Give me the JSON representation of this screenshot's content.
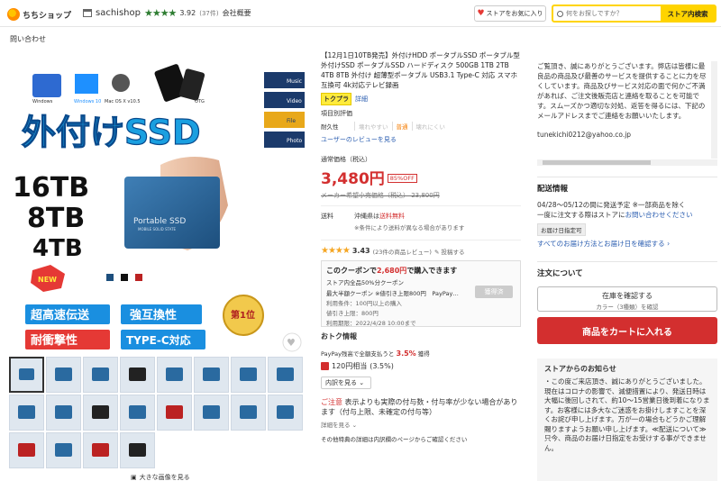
{
  "header": {
    "logo_text": "ちちショップ",
    "shop_name": "sachishop",
    "stars": "★★★★",
    "rating": "3.92",
    "rating_count": "(37件)",
    "company_link": "会社概要",
    "fav_label": "ストアをお気に入り",
    "search_placeholder": "何をお探しですか？",
    "search_button": "ストア内検索"
  },
  "inquiry": "問い合わせ",
  "main_image": {
    "compat": [
      "Windows",
      "Windows 10",
      "Mac OS X v10.5",
      "OTG"
    ],
    "side_icons": [
      "Music",
      "Video",
      "File",
      "Photo"
    ],
    "headline": "外付けSSD",
    "capacities": [
      "16TB",
      "8TB",
      "4TB"
    ],
    "device_label": "Portable SSD",
    "device_sub": "MOBILE SOLID STATE",
    "new_badge": "NEW",
    "rank_badge": "第1位",
    "features": [
      "超高速伝送",
      "強互換性",
      "耐衝撃性",
      "TYPE-C対応"
    ]
  },
  "big_image_link": "大きな画像を見る",
  "product": {
    "title": "【12月1日10TB発売】外付けHDD ポータブルSSD ポータブル型外付けSSD ポータブルSSD ハードディスク 500GB 1TB 2TB 4TB 8TB 外付け 超薄型ポータブル USB3.1 Type-C 対応 スマホ互換可 4k対応テレビ録画",
    "tokku_label": "トクプラ",
    "detail_link": "詳細",
    "eval_title": "項目別評価",
    "eval_label": "耐久性",
    "eval_opts": [
      "壊れやすい",
      "普通",
      "壊れにくい"
    ],
    "user_review_link": "ユーザーのレビューを見る",
    "price_label": "通常価格（税込）",
    "price": "3,480円",
    "discount": "85%OFF",
    "orig_price": "メーカー希望小売価格（税込） 23,800円",
    "ship_label": "送料",
    "ship_text_pre": "沖縄県は",
    "ship_text_free": "送料無料",
    "ship_note": "※条件により送料が異なる場合があります",
    "review_stars": "★★★★",
    "review_score": "3.43",
    "review_count": "(23件の商品レビュー)",
    "post_review": "投稿する"
  },
  "coupon": {
    "title_pre": "このクーポンで",
    "title_hl": "2,680円",
    "title_post": "で購入できます",
    "line1": "ストア内全品50%分クーポン",
    "line2": "最大半額クーポン ※値引き上限800円　PayPay…",
    "meta1": "利用条件：100円以上の購入",
    "meta2": "値引き上限：800円",
    "meta3": "利用期限：2022/4/28 10:00まで",
    "got_button": "獲得済"
  },
  "otoku": {
    "title": "おトク情報",
    "paypay_pre": "PayPay残高で全額支払うと",
    "paypay_pct": "3.5%",
    "paypay_post": "獲得",
    "points": "120円相当",
    "points_pct": "(3.5%)",
    "detail_select": "内訳を見る"
  },
  "caution": {
    "accent": "ご注意",
    "text": "表示よりも実際の付与数・付与率が少ない場合があります（付与上限、未確定の付与等）",
    "see_detail": "詳細を見る",
    "other": "その他特典の詳細は内訳欄のページからご確認ください"
  },
  "store_msg": "ご覧頂き、誠にありがとうございます。弊店は皆様に最良品の商品及び最善のサービスを提供することに力を尽くしています。商品及びサービス対応の面で何かご不満があれば、ご注文後販売店と連絡を取ることを可能です。スムーズかつ適切な対処、返答を得るには、下記のメールアドレスまでご連絡をお願いいたします。",
  "store_email": "tunekichi0212@yahoo.co.jp",
  "shipping": {
    "title": "配送情報",
    "date_range": "04/28〜05/12の間に発送予定",
    "date_note": "※一部商品を除く",
    "date_note2": "一度に注文する際はストアに",
    "date_link": "お問い合わせください",
    "tag": "お届け日指定可",
    "link": "すべてのお届け方法とお届け日を確認する"
  },
  "order": {
    "title": "注文について",
    "stock_btn": "在庫を確認する",
    "stock_sub": "カラー（3種類）を確認",
    "cart_btn": "商品をカートに入れる"
  },
  "notice": {
    "title": "ストアからのお知らせ",
    "body": "・この度ご来店頂き、誠にありがとうございました。現在はコロナの影響で、減便措置により、発送日時は大幅に後回しされて、約10〜15営業日後到着になります。お客様には多大なご迷惑をお掛けしますことを深くお詫び申し上げます。万が一の場合もどうかご理解賜りますようお願い申し上げます。≪配送について≫只今、商品のお届け日指定をお受けする事ができません。"
  }
}
